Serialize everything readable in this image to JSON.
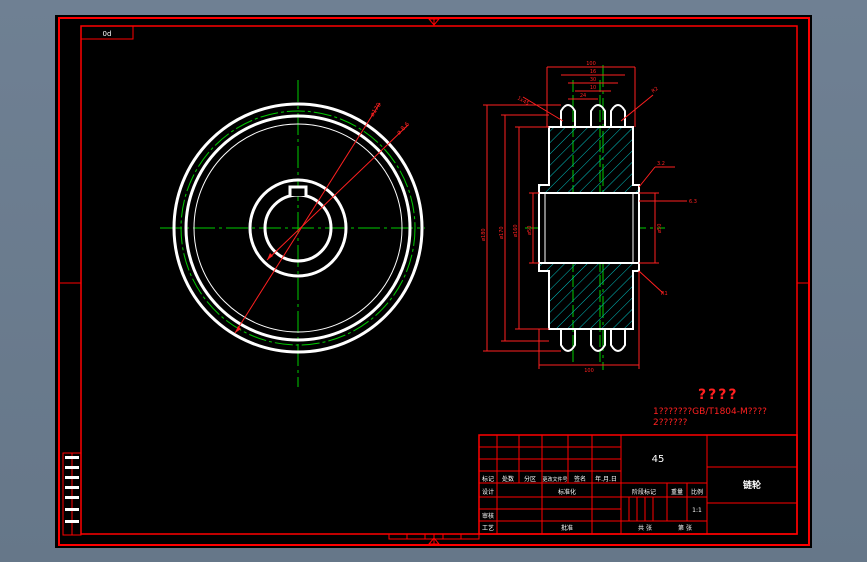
{
  "colors": {
    "background": "#000000",
    "border": "#ff0000",
    "outline": "#ffffff",
    "centerline": "#00cc00",
    "hatch": "#00bfbf",
    "dimension": "#ff2020",
    "title_text": "#ffffff"
  },
  "drawing": {
    "corner_code": "0d",
    "notes": {
      "heading": "????",
      "line1": "1???????GB/T1804-M????",
      "line2": "2??????"
    },
    "dimensions": {
      "tooth_dia": "ø170",
      "hub_dia": "ø 8.6",
      "width_top": "100",
      "width_top_inner": "16",
      "width_top_b": "30",
      "width_top_c": "10",
      "width_mid": "24",
      "width_bottom": "100",
      "chamfer_left": "1x45",
      "r_top": "R2",
      "roughness_right1": "3.2",
      "roughness_right2": "6.3",
      "r_bottom": "R1",
      "dia_outer": "ø180",
      "dia_root": "ø170",
      "dia_hub": "ø160",
      "dia_bore": "ø50",
      "dia_bore2": "ø50"
    },
    "title_block": {
      "material": "45",
      "part_name": "链轮",
      "row_labels": [
        "标记",
        "处数",
        "分区",
        "更改文件号",
        "签名",
        "年.月.日"
      ],
      "design": "设计",
      "standardize": "标准化",
      "review": "审核",
      "process": "工艺",
      "approve": "批准",
      "stage_mark": "阶段标记",
      "weight": "重量",
      "scale": "比例",
      "scale_value": "1:1",
      "sheets": "共  张",
      "sheet_of": "第  张"
    },
    "side_marks": [
      "",
      "",
      "",
      "",
      "",
      "",
      ""
    ]
  }
}
